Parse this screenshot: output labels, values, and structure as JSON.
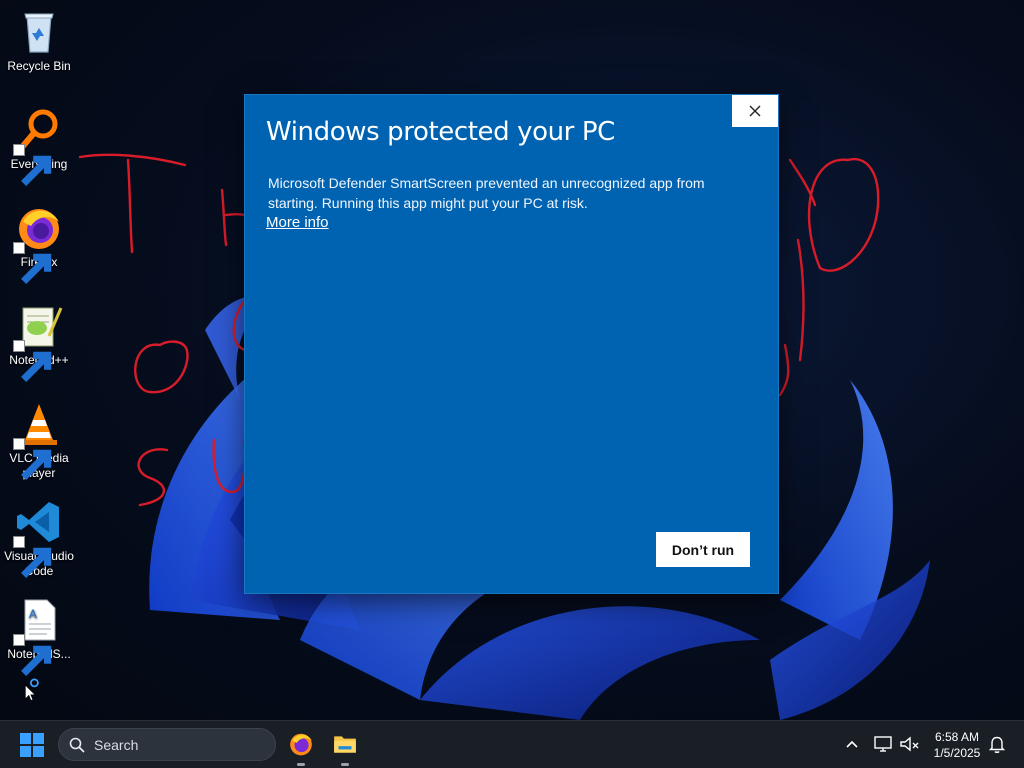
{
  "desktop": {
    "icons": [
      {
        "label": "Recycle Bin",
        "icon": "recycle-bin-icon",
        "shortcut": false
      },
      {
        "label": "Everything",
        "icon": "everything-search-icon",
        "shortcut": true
      },
      {
        "label": "Firefox",
        "icon": "firefox-icon",
        "shortcut": true
      },
      {
        "label": "Notepad++",
        "icon": "notepad-plus-plus-icon",
        "shortcut": true
      },
      {
        "label": "VLC media player",
        "icon": "vlc-cone-icon",
        "shortcut": true
      },
      {
        "label": "Visual Studio Code",
        "icon": "vscode-icon",
        "shortcut": true
      },
      {
        "label": "NotepadS...",
        "icon": "text-document-icon",
        "shortcut": true
      }
    ],
    "scribble_color": "#d81c2a"
  },
  "dialog": {
    "title": "Windows protected your PC",
    "message": "Microsoft Defender SmartScreen prevented an unrecognized app from starting. Running this app might put your PC at risk.",
    "more_info_link": "More info",
    "dont_run_button": "Don’t run",
    "close_icon": "close-icon",
    "background_color": "#0063b1"
  },
  "taskbar": {
    "search_placeholder": "Search",
    "pinned_apps": [
      "Firefox",
      "File Explorer"
    ],
    "tray_icons": [
      "chevron-up-icon",
      "network-monitor-icon",
      "speaker-muted-icon",
      "notification-bell-icon"
    ],
    "time": "6:58 AM",
    "date": "1/5/2025"
  }
}
